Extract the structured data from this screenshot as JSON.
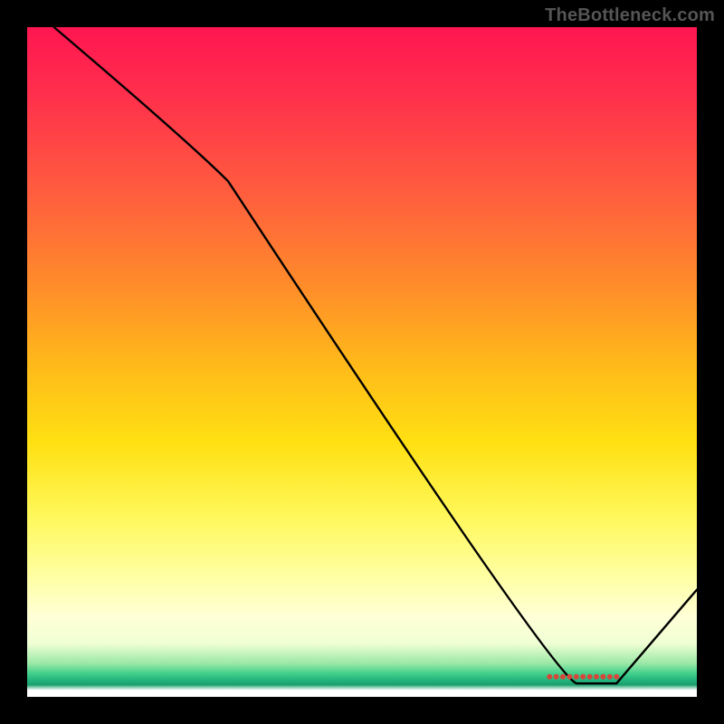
{
  "watermark": "TheBottleneck.com",
  "chart_data": {
    "type": "line",
    "title": "",
    "xlabel": "",
    "ylabel": "",
    "xlim": [
      0,
      100
    ],
    "ylim": [
      0,
      100
    ],
    "grid": false,
    "legend": false,
    "background_gradient": {
      "direction": "top-to-bottom",
      "stops": [
        {
          "pos": 0.0,
          "color": "#ff1651"
        },
        {
          "pos": 0.1,
          "color": "#ff2f4c"
        },
        {
          "pos": 0.25,
          "color": "#ff5e3e"
        },
        {
          "pos": 0.38,
          "color": "#ff8a2b"
        },
        {
          "pos": 0.5,
          "color": "#ffb81a"
        },
        {
          "pos": 0.62,
          "color": "#ffe012"
        },
        {
          "pos": 0.73,
          "color": "#fff85a"
        },
        {
          "pos": 0.82,
          "color": "#ffffa3"
        },
        {
          "pos": 0.88,
          "color": "#ffffd6"
        },
        {
          "pos": 0.92,
          "color": "#f0ffd4"
        },
        {
          "pos": 0.95,
          "color": "#9be8a7"
        },
        {
          "pos": 0.965,
          "color": "#42d08b"
        },
        {
          "pos": 0.975,
          "color": "#24b47e"
        },
        {
          "pos": 0.982,
          "color": "#1aa06a"
        },
        {
          "pos": 0.99,
          "color": "#ffffff"
        },
        {
          "pos": 1.0,
          "color": "#ffffff"
        }
      ]
    },
    "series": [
      {
        "name": "bottleneck-curve",
        "color": "#000000",
        "stroke_width": 2.4,
        "points": [
          {
            "x": 4,
            "y": 100
          },
          {
            "x": 24,
            "y": 83
          },
          {
            "x": 30,
            "y": 77
          },
          {
            "x": 78,
            "y": 4
          },
          {
            "x": 82,
            "y": 2
          },
          {
            "x": 88,
            "y": 2
          },
          {
            "x": 100,
            "y": 16
          }
        ]
      }
    ],
    "markers": [
      {
        "name": "flat-minimum-dots",
        "shape": "circle",
        "color": "#d8463a",
        "radius": 3,
        "points": [
          {
            "x": 78,
            "y": 3
          },
          {
            "x": 79,
            "y": 3
          },
          {
            "x": 80,
            "y": 3
          },
          {
            "x": 81,
            "y": 3
          },
          {
            "x": 82,
            "y": 3
          },
          {
            "x": 83,
            "y": 3
          },
          {
            "x": 84,
            "y": 3
          },
          {
            "x": 85,
            "y": 3
          },
          {
            "x": 86,
            "y": 3
          },
          {
            "x": 87,
            "y": 3
          },
          {
            "x": 88,
            "y": 3
          }
        ]
      }
    ]
  }
}
